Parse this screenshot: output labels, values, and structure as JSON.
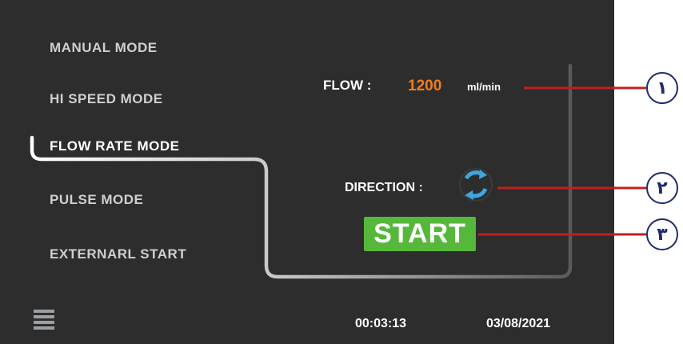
{
  "modes": {
    "manual": "MANUAL MODE",
    "hi_speed": "HI SPEED MODE",
    "flow_rate": "FLOW RATE MODE",
    "pulse": "PULSE MODE",
    "external": "EXTERNARL START",
    "selected": "FLOW RATE MODE"
  },
  "flow": {
    "label": "FLOW :",
    "value": "1200",
    "unit": "ml/min"
  },
  "direction": {
    "label": "DIRECTION :",
    "icon": "rotate-arrows-icon"
  },
  "start_button": {
    "label": "START"
  },
  "status_bar": {
    "menu_icon": "hamburger-menu-icon",
    "time": "00:03:13",
    "date": "03/08/2021"
  },
  "annotations": {
    "callout_1": "١",
    "callout_2": "٢",
    "callout_3": "٣"
  },
  "colors": {
    "background": "#2d2d2d",
    "flow_value": "#f07d1e",
    "start_button": "#55b83a",
    "callout_line": "#c0201e",
    "callout_circle": "#1d2a6e"
  }
}
